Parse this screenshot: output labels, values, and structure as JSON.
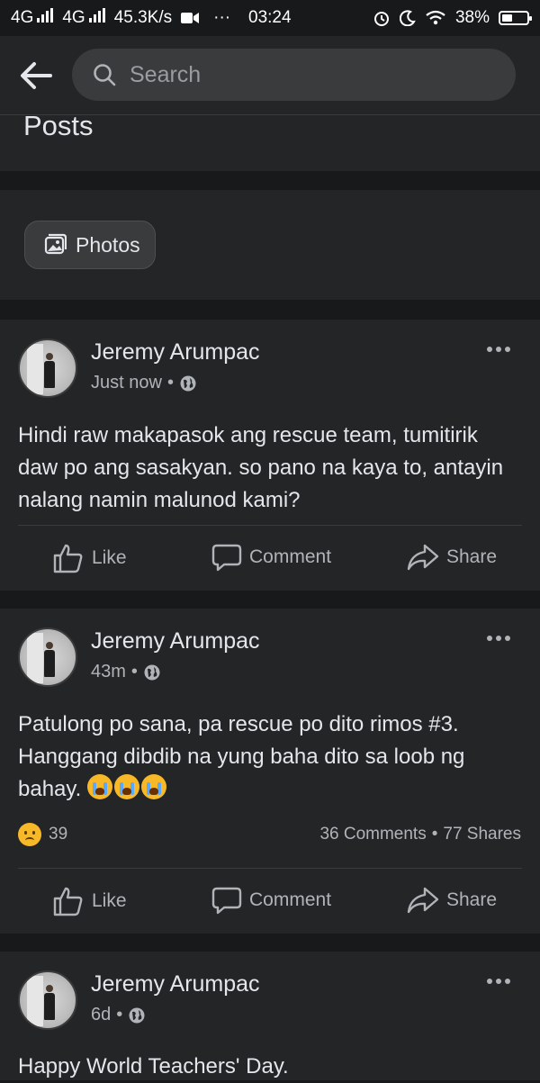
{
  "status_bar": {
    "network1": "4G",
    "network2": "4G",
    "speed": "45.3K/s",
    "more": "···",
    "time": "03:24",
    "battery": "38%"
  },
  "top_bar": {
    "search_placeholder": "Search"
  },
  "section": {
    "title": "Posts"
  },
  "filters": {
    "photos_label": "Photos"
  },
  "actions": {
    "like": "Like",
    "comment": "Comment",
    "share": "Share"
  },
  "posts": [
    {
      "author": "Jeremy Arumpac",
      "time": "Just now",
      "privacy_icon": "globe-icon",
      "text": "Hindi raw makapasok ang rescue team, tumitirik daw po ang sasakyan. so pano na kaya to, antayin nalang namin malunod kami?"
    },
    {
      "author": "Jeremy Arumpac",
      "time": "43m",
      "privacy_icon": "globe-icon",
      "text": "Patulong po sana, pa rescue po dito rimos #3. Hanggang dibdib na yung baha dito sa loob ng bahay.",
      "reactions_count": "39",
      "comments": "36 Comments",
      "shares": "77 Shares"
    },
    {
      "author": "Jeremy Arumpac",
      "time": "6d",
      "privacy_icon": "globe-icon",
      "text": "Happy World Teachers' Day."
    }
  ]
}
